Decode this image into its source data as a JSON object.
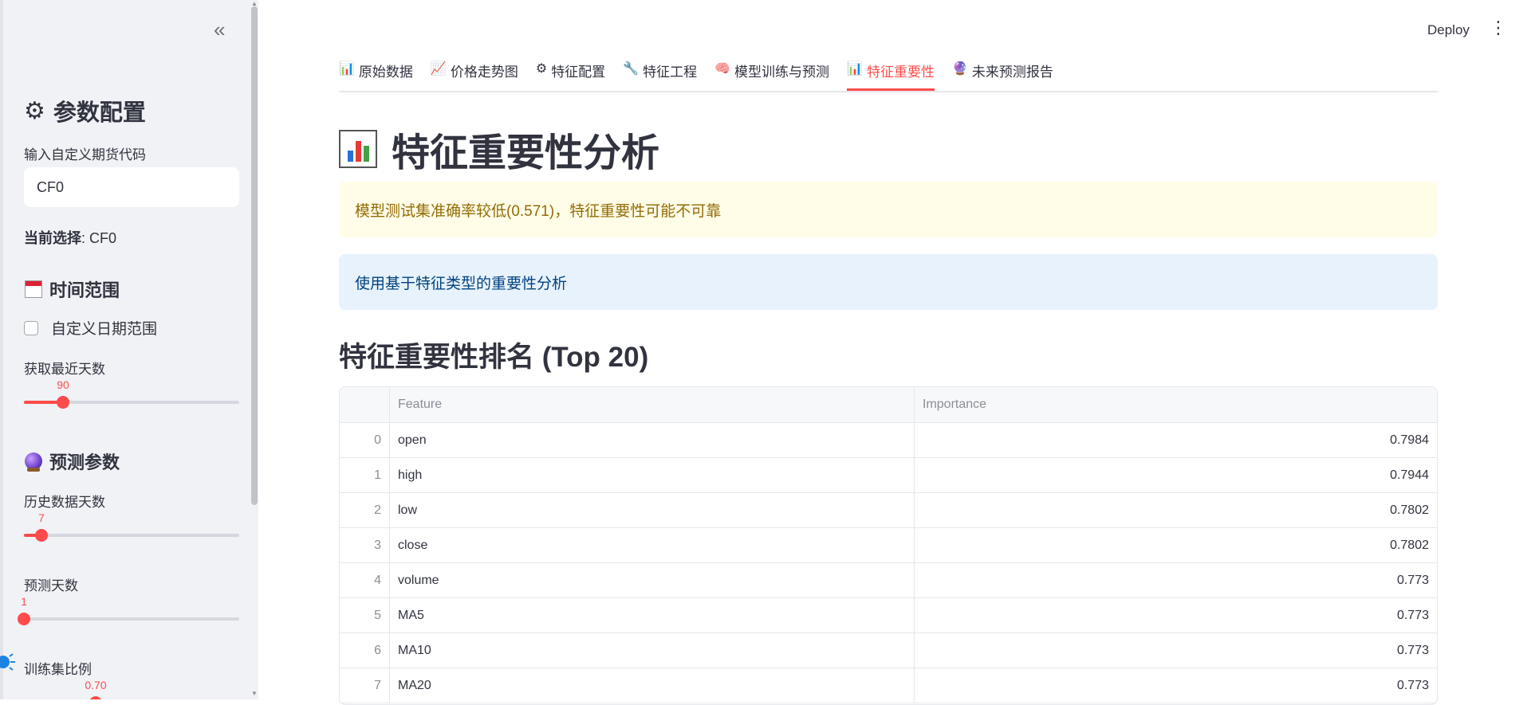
{
  "sidebar": {
    "collapse_icon": "«",
    "title_icon": "⚙",
    "title": "参数配置",
    "code_label": "输入自定义期货代码",
    "code_value": "CF0",
    "current_label": "当前选择",
    "current_value": ": CF0",
    "time_section": "时间范围",
    "custom_date_label": "自定义日期范围",
    "recent_days_label": "获取最近天数",
    "recent_days_value": "90",
    "recent_days_fraction": 0.18,
    "forecast_section": "预测参数",
    "history_days_label": "历史数据天数",
    "history_days_value": "7",
    "history_days_fraction": 0.08,
    "predict_days_label": "预测天数",
    "predict_days_value": "1",
    "predict_days_fraction": 0.0,
    "train_ratio_label": "训练集比例",
    "train_ratio_value": "0.70"
  },
  "header": {
    "deploy_label": "Deploy",
    "menu_icon": "⋮"
  },
  "tabs": [
    {
      "icon": "📊",
      "label": "原始数据"
    },
    {
      "icon": "📈",
      "label": "价格走势图"
    },
    {
      "icon": "⚙",
      "label": "特征配置"
    },
    {
      "icon": "🔧",
      "label": "特征工程"
    },
    {
      "icon": "🧠",
      "label": "模型训练与预测"
    },
    {
      "icon": "📊",
      "label": "特征重要性"
    },
    {
      "icon": "🔮",
      "label": "未来预测报告"
    }
  ],
  "main": {
    "title": "特征重要性分析",
    "warning": "模型测试集准确率较低(0.571)，特征重要性可能不可靠",
    "info": "使用基于特征类型的重要性分析",
    "section_title": "特征重要性排名 (Top 20)"
  },
  "table": {
    "columns": [
      "",
      "Feature",
      "Importance"
    ],
    "rows": [
      {
        "idx": "0",
        "feature": "open",
        "importance": "0.7984"
      },
      {
        "idx": "1",
        "feature": "high",
        "importance": "0.7944"
      },
      {
        "idx": "2",
        "feature": "low",
        "importance": "0.7802"
      },
      {
        "idx": "3",
        "feature": "close",
        "importance": "0.7802"
      },
      {
        "idx": "4",
        "feature": "volume",
        "importance": "0.773"
      },
      {
        "idx": "5",
        "feature": "MA5",
        "importance": "0.773"
      },
      {
        "idx": "6",
        "feature": "MA10",
        "importance": "0.773"
      },
      {
        "idx": "7",
        "feature": "MA20",
        "importance": "0.773"
      }
    ]
  },
  "colors": {
    "accent": "#ff4b4b",
    "warning_bg": "#fffce7",
    "warning_text": "#926c05",
    "info_bg": "#e8f2fc",
    "info_text": "#004280"
  }
}
